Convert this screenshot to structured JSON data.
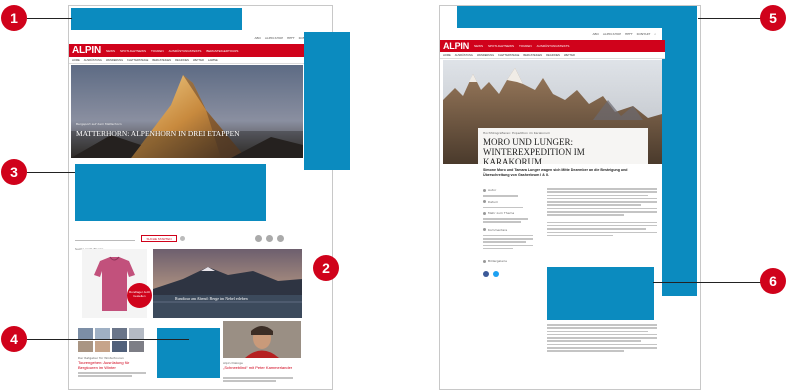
{
  "callouts": [
    "1",
    "2",
    "3",
    "4",
    "5",
    "6"
  ],
  "colors": {
    "ad_blue": "#0b8bbf",
    "brand_red": "#d0021b",
    "callout_red": "#d0021b"
  },
  "left_page": {
    "topbar_links": [
      "ABO",
      "ALPIN-SHOP",
      "HEFT",
      "KONTAKT"
    ],
    "logo": "ALPIN",
    "nav": [
      "NEWS",
      "SPOTLIGHTNEWS",
      "TOUREN",
      "AUSRÜSTUNGSTESTS",
      "BERGSTEIGERTOURS"
    ],
    "subnav": [
      "HOME",
      "AUSRÜSTUNG",
      "WANDERUNG",
      "KLETTERSTEIGE",
      "BERGSTEIGEN",
      "REGIONEN",
      "WETTER",
      "LAWINE",
      "BERGHÜTTEN",
      "BERGGESUNDHEIT"
    ],
    "hero_title": "MATTERHORN: ALPENHORN IN DREI ETAPPEN",
    "hero_subtitle": "Bergsport auf dem Matterhorn",
    "search_label": "Suche nach Touren",
    "search_button": "SUCHE STARTEN",
    "promo_caption": "Rundtour am Abend: Berge im Nebel erleben",
    "product_badge": "Rundlager Jetzt bestellen",
    "teaser1_kicker": "Der Ratgeber für Wintertouren",
    "teaser1_title": "Tourengehen: Ausrüstung für Bergtouren im Winter",
    "teaser2_kicker": "Alpin Dialoge",
    "teaser2_title": "„Schneeblind“ mit Peter Kammerlander"
  },
  "right_page": {
    "topbar_links": [
      "ABO",
      "ALPIN-SHOP",
      "HEFT",
      "KONTAKT"
    ],
    "logo": "ALPIN",
    "nav": [
      "NEWS",
      "SPOTLIGHTNEWS",
      "TOUREN",
      "AUSRÜSTUNGSTESTS",
      "BERGSTEIGERTOURS"
    ],
    "subnav": [
      "HOME",
      "AUSRÜSTUNG",
      "WANDERUNG",
      "KLETTERSTEIGE",
      "BERGSTEIGEN",
      "REGIONEN",
      "WETTER",
      "LAWINE",
      "BERGHÜTTEN",
      "BERGGESUNDHEIT"
    ],
    "kicker": "Hochfotografieren: Expedition im Karakorum",
    "headline_line1": "MORO UND LUNGER:",
    "headline_line2": "WINTEREXPEDITION IM KARAKORUM",
    "lead": "Simone Moro und Tamara Lunger wagen sich Mitte Dezember an die Besteigung und Überschreitung von Gasherbrum I & II.",
    "meta_items": [
      "Autor",
      "Datum",
      "Mehr zum Thema",
      "Kommentare",
      "Bildergalerie"
    ]
  }
}
